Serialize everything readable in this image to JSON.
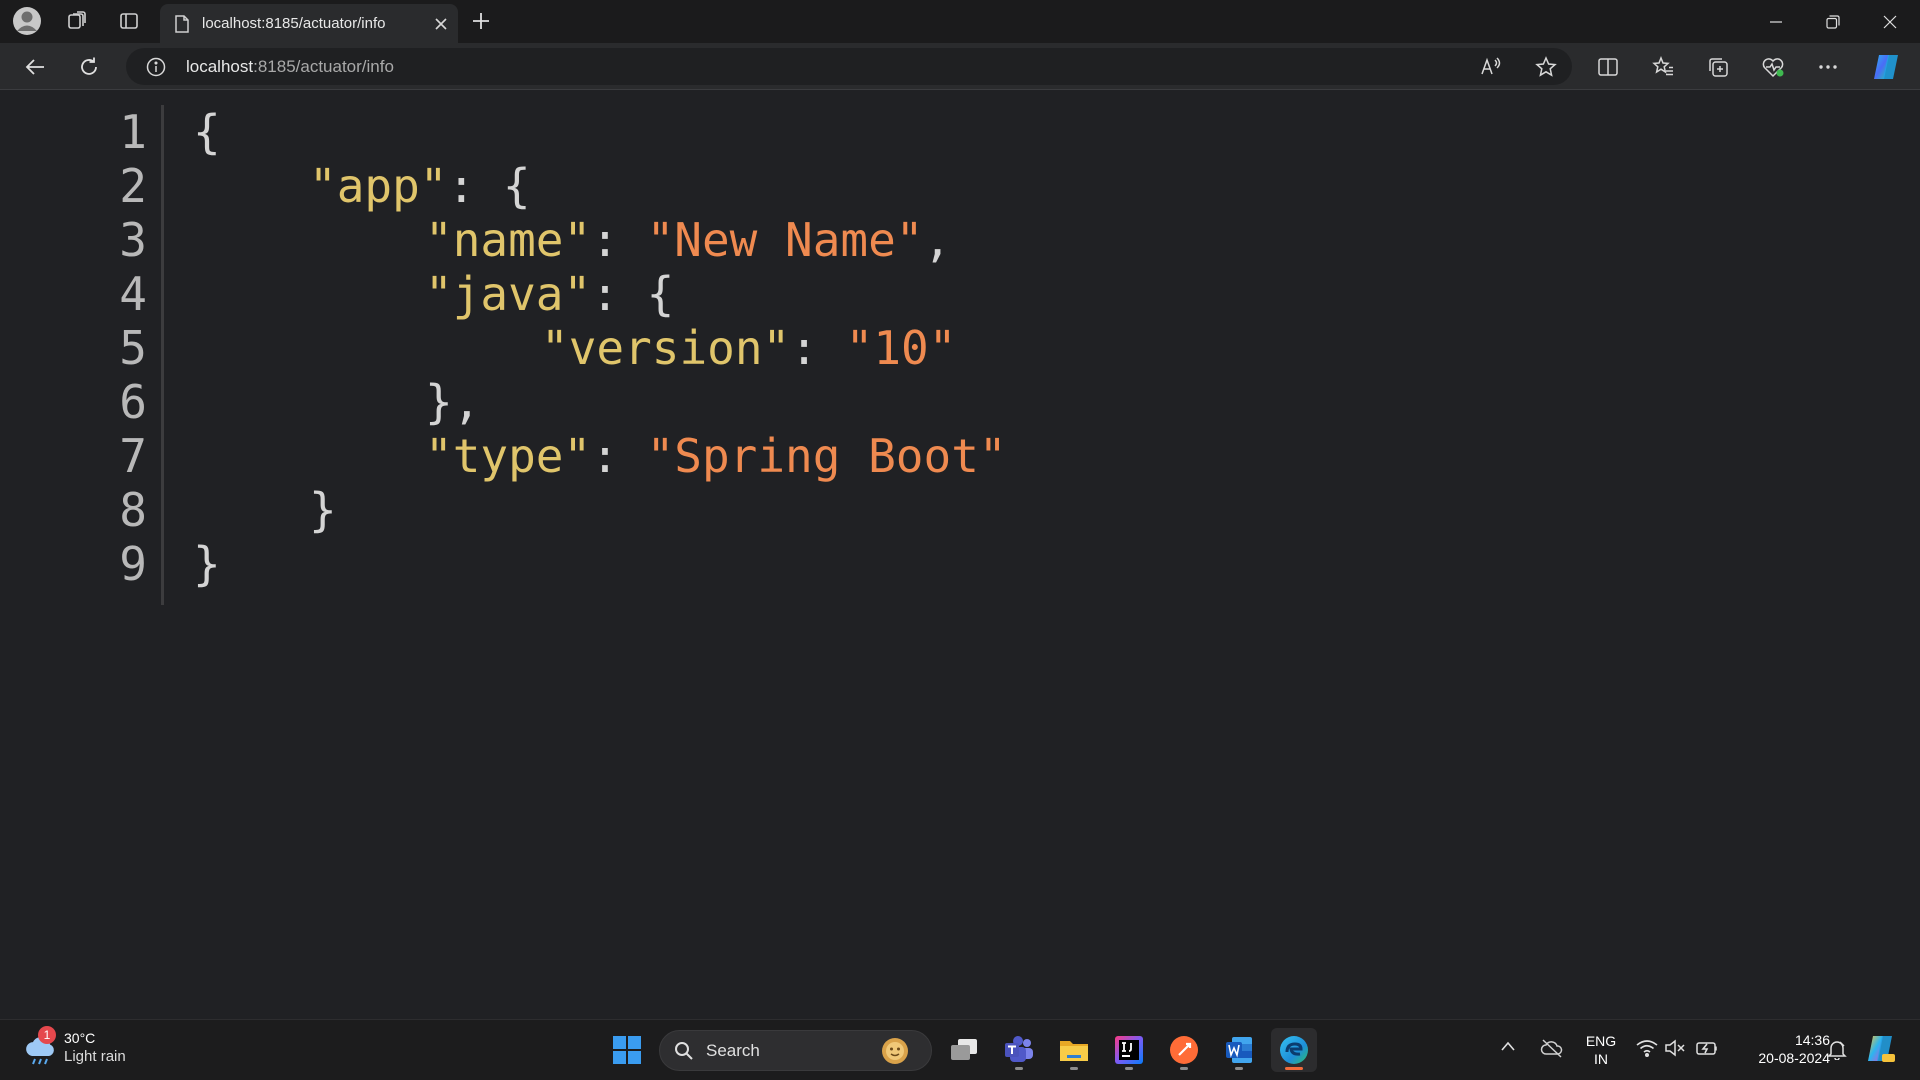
{
  "browser": {
    "tab_title": "localhost:8185/actuator/info",
    "url_host": "localhost",
    "url_rest": ":8185/actuator/info",
    "new_tab_glyph": "+",
    "icons": [
      "profile-icon",
      "workspaces-icon",
      "tab-actions-icon",
      "page-icon",
      "close-tab-icon",
      "new-tab-icon",
      "back-icon",
      "refresh-icon",
      "site-info-icon",
      "read-aloud-icon",
      "add-favorite-icon",
      "split-screen-icon",
      "favorites-icon",
      "collections-icon",
      "browser-essentials-icon",
      "more-icon",
      "copilot-icon"
    ]
  },
  "json_viewer": {
    "line_numbers": [
      "1",
      "2",
      "3",
      "4",
      "5",
      "6",
      "7",
      "8",
      "9"
    ],
    "tokens": {
      "open_brace": "{",
      "close_brace": "}",
      "close_brace_comma": "},",
      "colon": ": ",
      "comma": ",",
      "key_app": "\"app\"",
      "key_name": "\"name\"",
      "val_name": "\"New Name\"",
      "key_java": "\"java\"",
      "key_version": "\"version\"",
      "val_version": "\"10\"",
      "key_type": "\"type\"",
      "val_type": "\"Spring Boot\""
    },
    "colors": {
      "key": "#e0c56b",
      "string": "#ef8a50",
      "punct": "#d4d4d4"
    }
  },
  "taskbar": {
    "weather_badge": "1",
    "weather_temp": "30°C",
    "weather_condition": "Light rain",
    "search_label": "Search",
    "lang_line1": "ENG",
    "lang_line2": "IN",
    "time": "14:36",
    "date": "20-08-2024",
    "apps": [
      "start-icon",
      "task-view-icon",
      "teams-icon",
      "file-explorer-icon",
      "intellij-icon",
      "postman-icon",
      "word-icon",
      "edge-icon"
    ]
  }
}
